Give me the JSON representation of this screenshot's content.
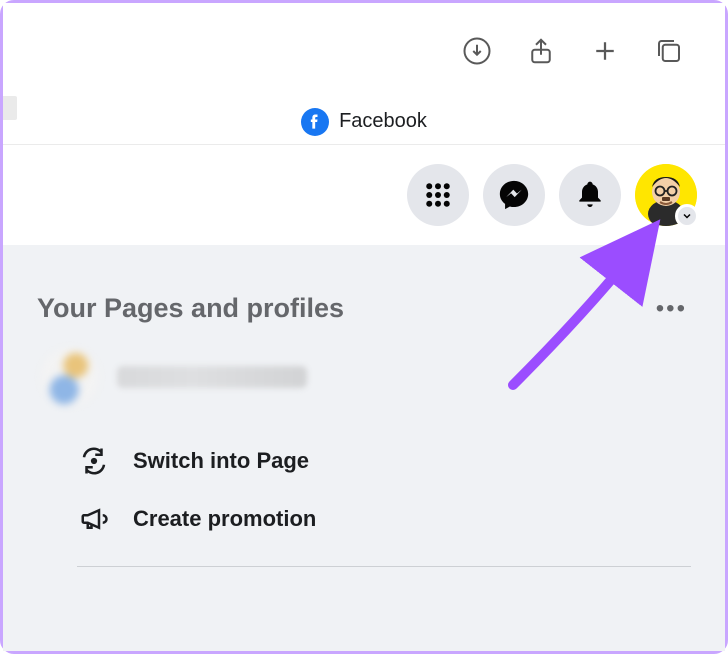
{
  "browser": {
    "tab_title": "Facebook"
  },
  "fb_header": {
    "profile_chevron": "v"
  },
  "section": {
    "title": "Your Pages and profiles",
    "actions": [
      {
        "label": "Switch into Page"
      },
      {
        "label": "Create promotion"
      }
    ]
  }
}
